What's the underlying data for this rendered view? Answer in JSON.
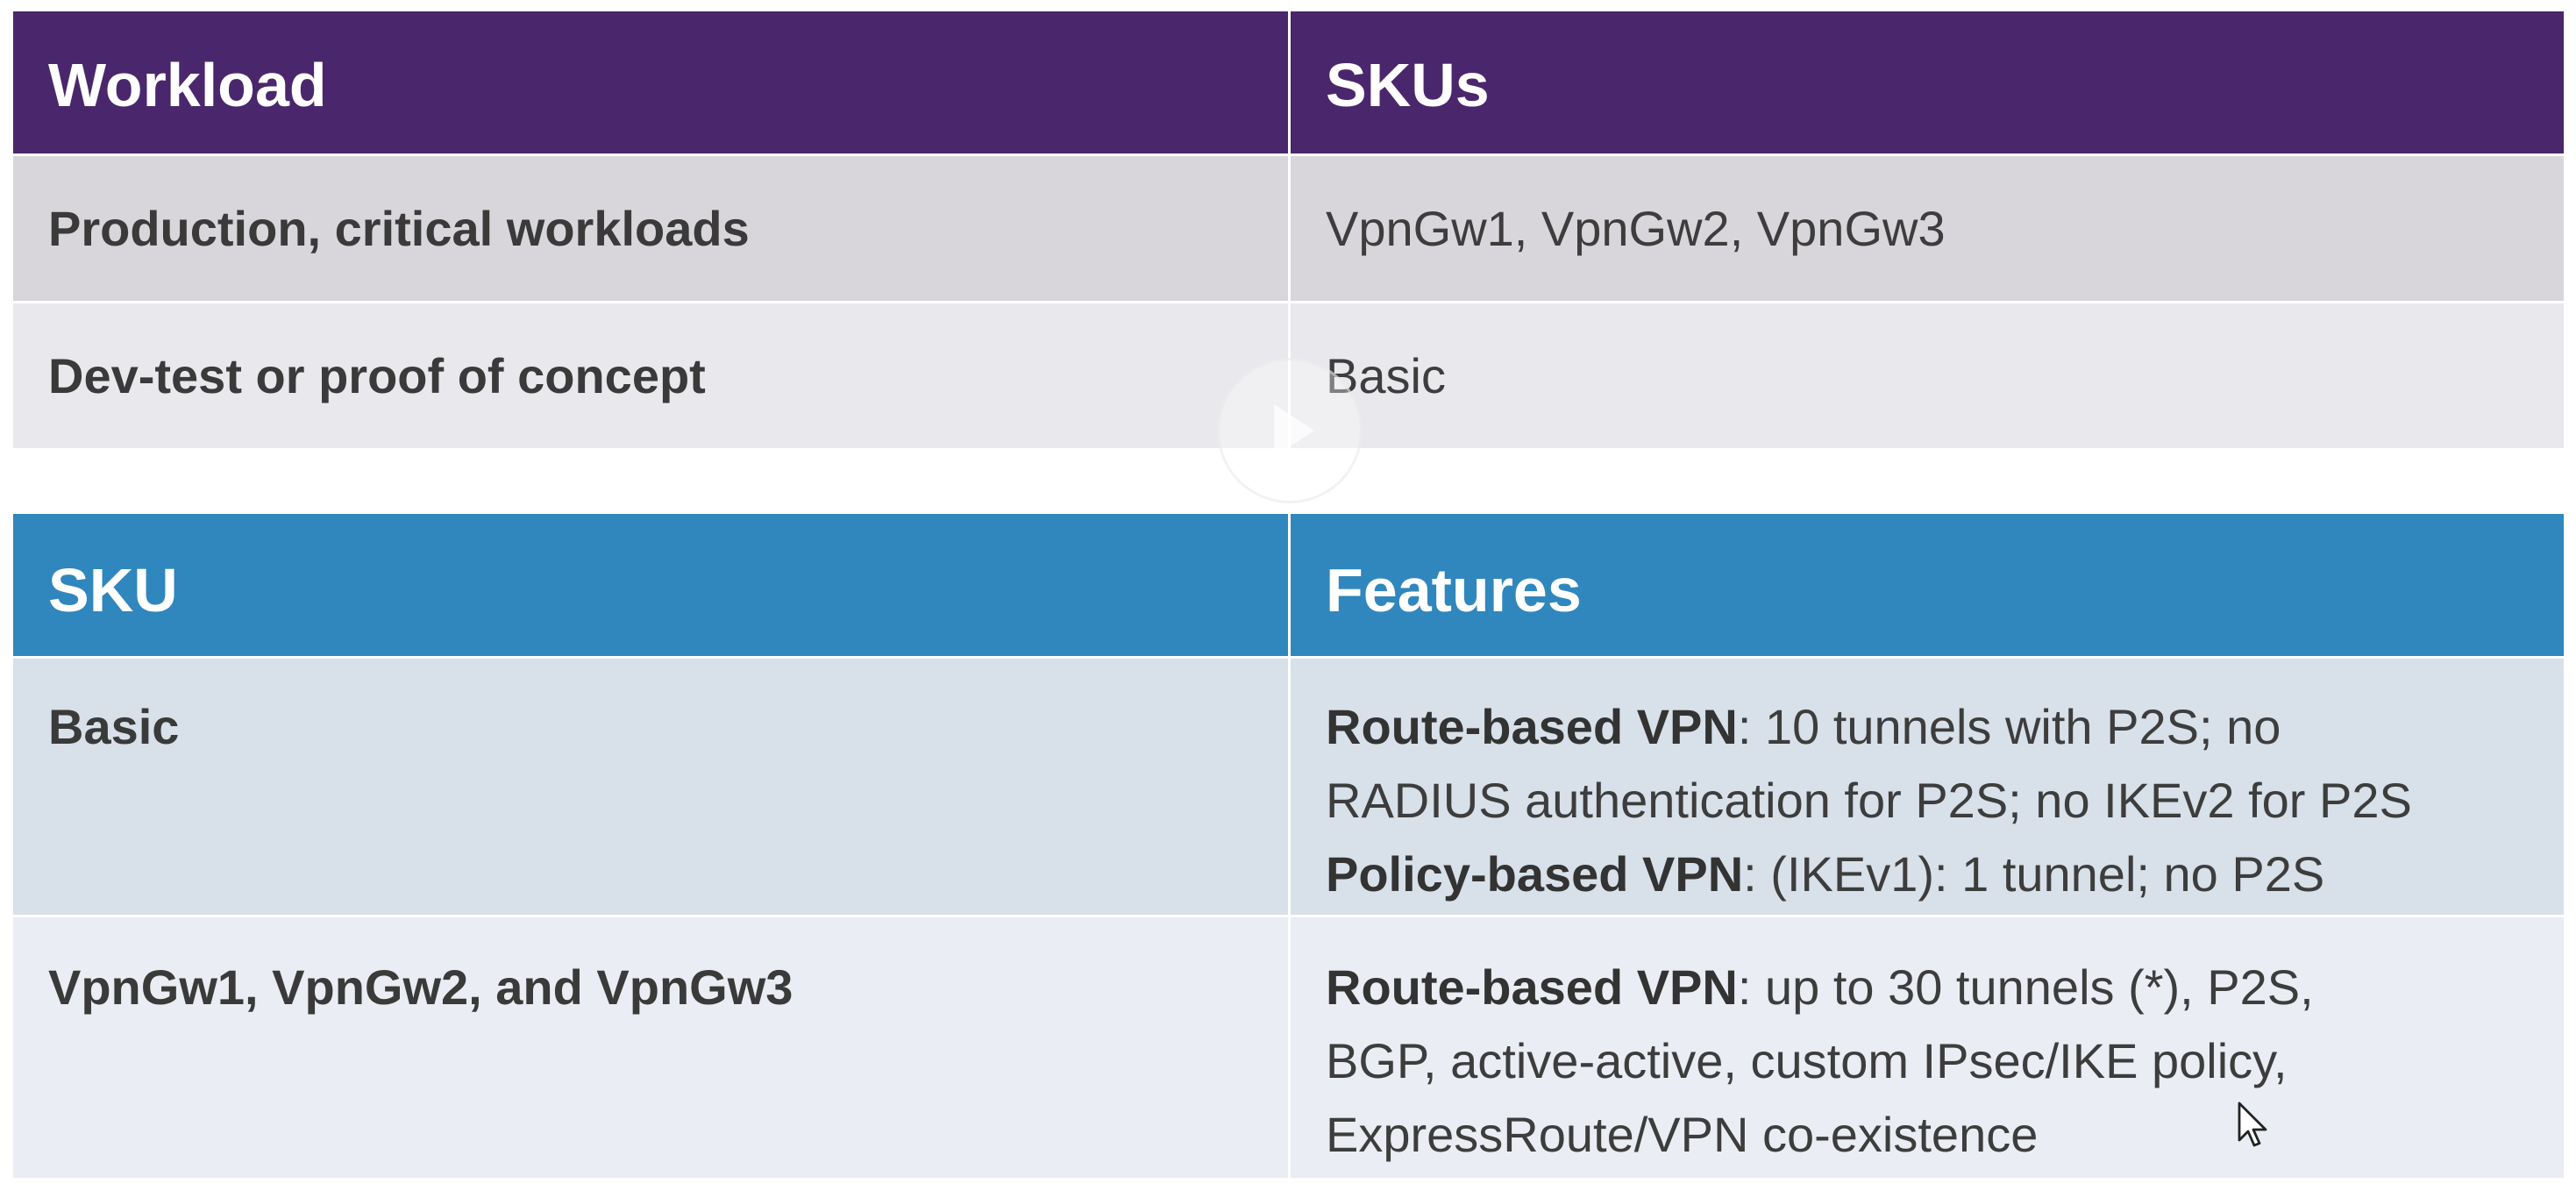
{
  "workload_table": {
    "header": {
      "col1": "Workload",
      "col2": "SKUs"
    },
    "rows": [
      {
        "workload": "Production, critical workloads",
        "skus": "VpnGw1, VpnGw2, VpnGw3"
      },
      {
        "workload": "Dev-test or proof of concept",
        "skus": "Basic"
      }
    ]
  },
  "sku_table": {
    "header": {
      "col1": "SKU",
      "col2": "Features"
    },
    "rows": [
      {
        "sku": "Basic",
        "features": [
          {
            "bold": "Route-based VPN",
            "text": ": 10 tunnels with P2S; no"
          },
          {
            "bold": "",
            "text": "RADIUS authentication for P2S; no IKEv2 for P2S"
          },
          {
            "bold": "Policy-based VPN",
            "text": ": (IKEv1): 1 tunnel; no P2S"
          }
        ]
      },
      {
        "sku": "VpnGw1, VpnGw2, and VpnGw3",
        "features": [
          {
            "bold": "Route-based VPN",
            "text": ": up to 30 tunnels (*), P2S,"
          },
          {
            "bold": "",
            "text": "BGP, active-active, custom IPsec/IKE policy,"
          },
          {
            "bold": "",
            "text": "ExpressRoute/VPN co-existence"
          }
        ]
      }
    ]
  },
  "colors": {
    "workload_header": "#4a276c",
    "sku_header": "#3087bd",
    "workload_row1": "#d8d6da",
    "workload_row2": "#e9e8ec",
    "sku_row1": "#d8e0e9",
    "sku_row2": "#eaedf3"
  },
  "icons": {
    "overlay": "play-icon",
    "pointer": "cursor-arrow-icon"
  }
}
